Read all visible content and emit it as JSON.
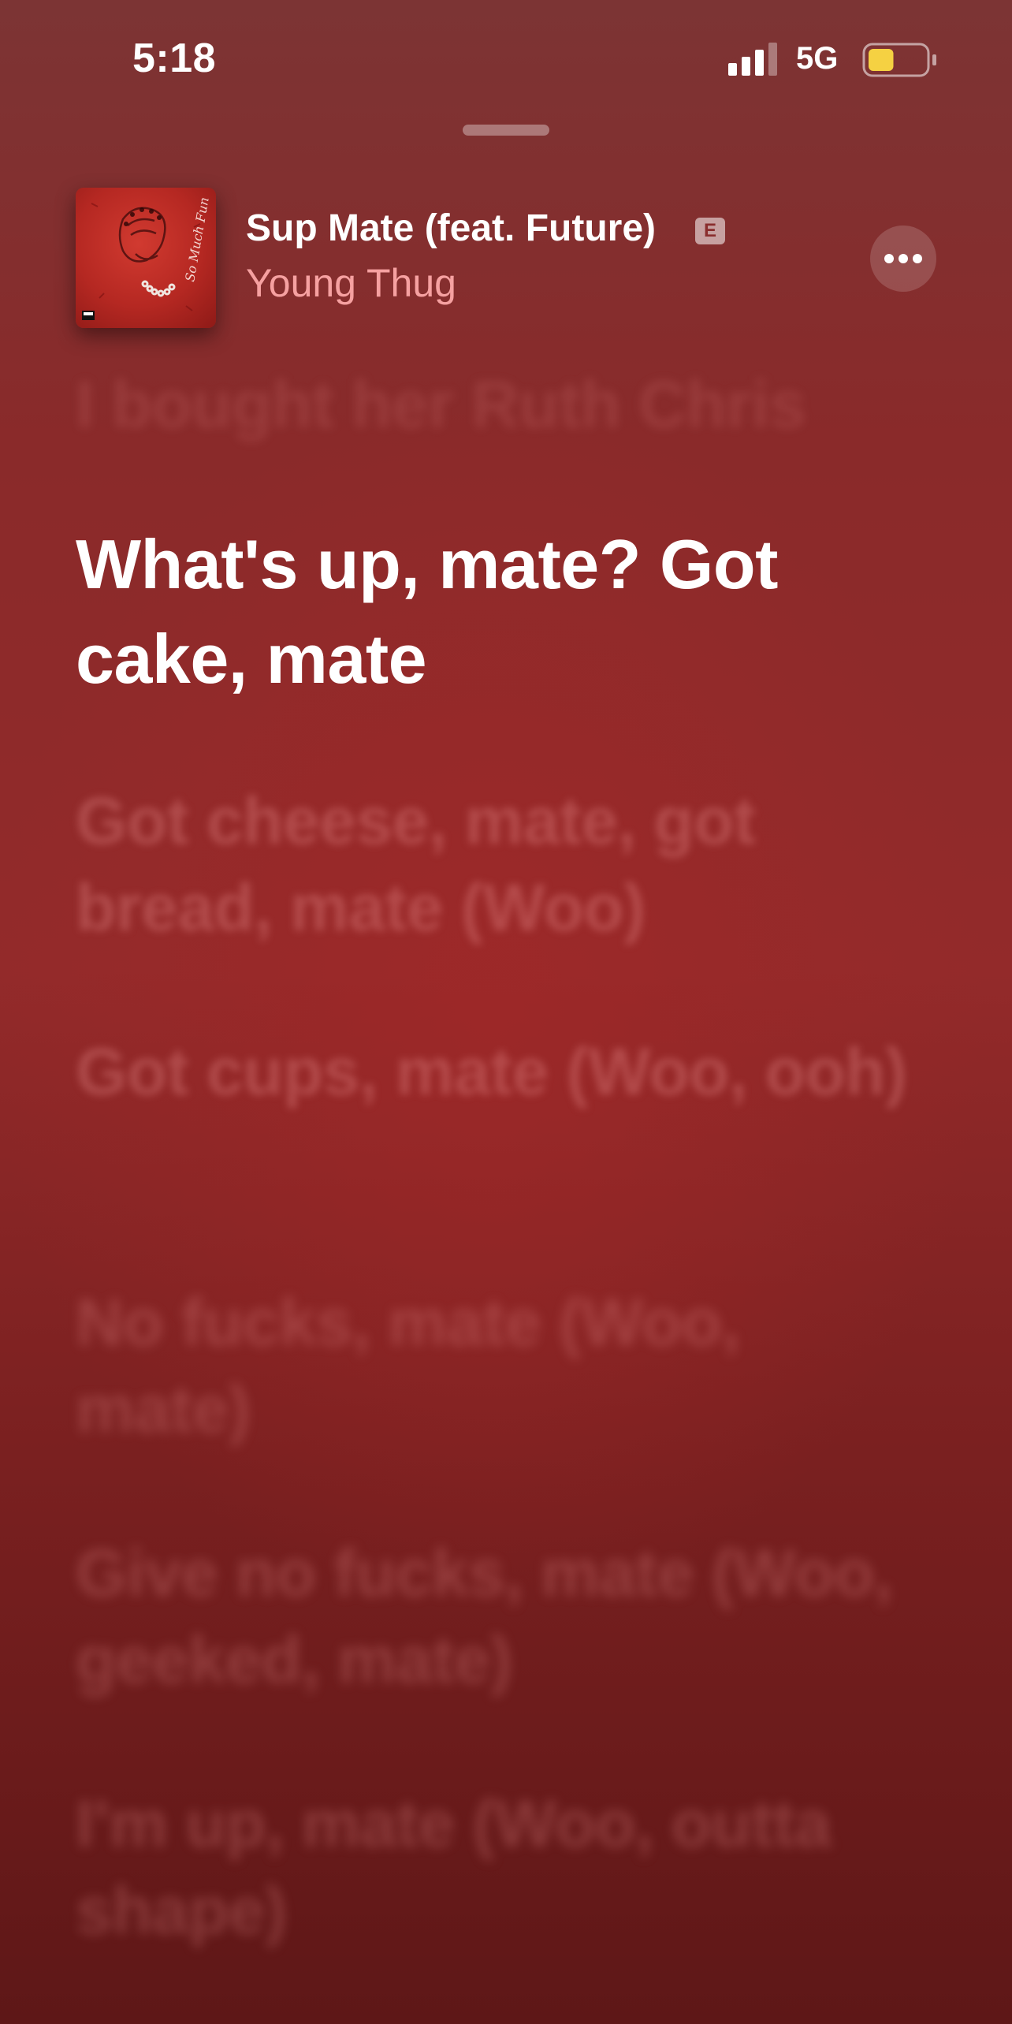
{
  "status_bar": {
    "time": "5:18",
    "network": "5G",
    "signal_bars": 3,
    "battery_level": 0.45,
    "battery_color": "#f5d142"
  },
  "now_playing": {
    "song_title": "Sup Mate (feat. Future)",
    "explicit_badge": "E",
    "artist": "Young Thug",
    "artwork_icon": "album-artwork-icon",
    "more_icon": "ellipsis-icon"
  },
  "lyrics": {
    "previous": "I bought her Ruth Chris",
    "current": "What's up, mate? Got cake, mate",
    "upcoming": [
      "Got cheese, mate, got bread, mate (Woo)",
      "Got cups, mate (Woo, ooh)",
      "No fucks, mate (Woo, mate)",
      "Give no fucks, mate (Woo, geeked, mate)",
      "I'm up, mate (Woo, outta shape)"
    ]
  },
  "colors": {
    "accent_artist": "#f6a1a1",
    "background_top": "#7c3434",
    "background_bottom": "#5e1717"
  }
}
